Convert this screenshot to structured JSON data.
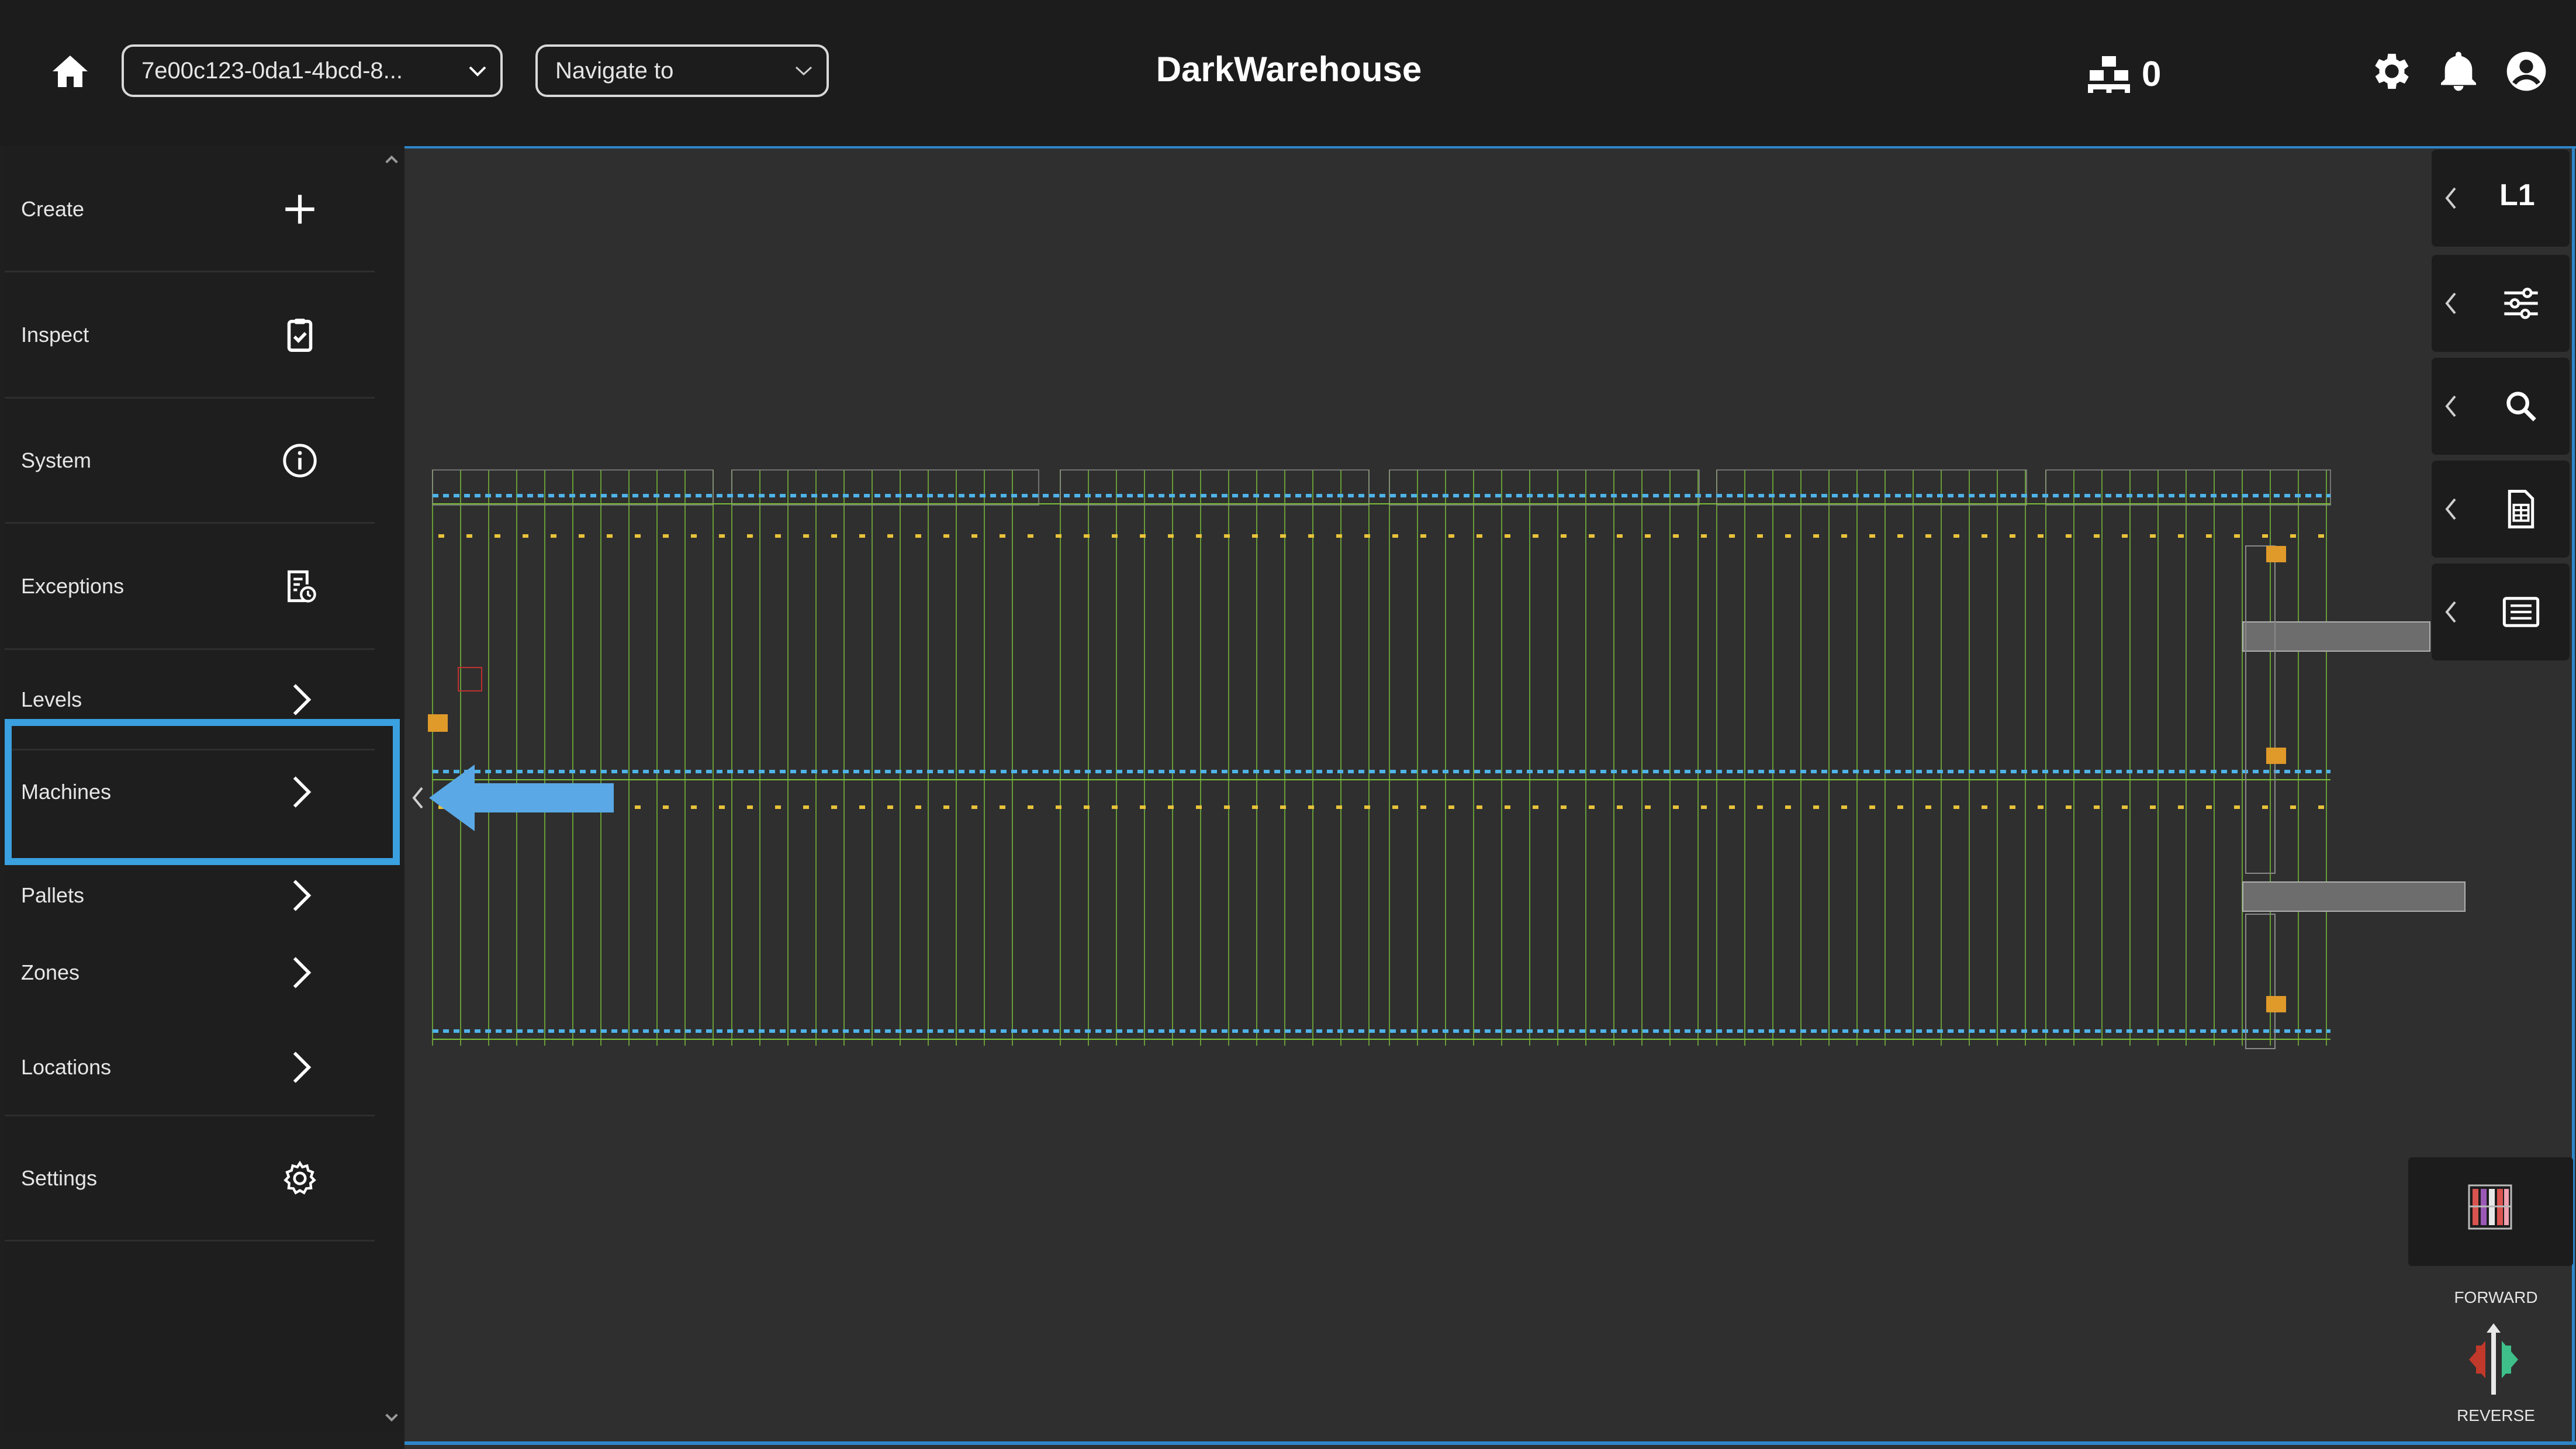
{
  "header": {
    "app_title": "DarkWarehouse",
    "site_select_value": "7e00c123-0da1-4bcd-8...",
    "navigate_placeholder": "Navigate to",
    "pallet_count": "0"
  },
  "sidebar": {
    "items": [
      {
        "label": "Create",
        "icon": "plus-icon"
      },
      {
        "label": "Inspect",
        "icon": "clipboard-check-icon"
      },
      {
        "label": "System",
        "icon": "info-icon"
      },
      {
        "label": "Exceptions",
        "icon": "report-clock-icon"
      },
      {
        "label": "Levels",
        "icon": "chevron-right-icon"
      },
      {
        "label": "Machines",
        "icon": "chevron-right-icon",
        "selected": true
      },
      {
        "label": "Pallets",
        "icon": "chevron-right-icon"
      },
      {
        "label": "Zones",
        "icon": "chevron-right-icon"
      },
      {
        "label": "Locations",
        "icon": "chevron-right-icon"
      },
      {
        "label": "Settings",
        "icon": "gear-icon"
      }
    ]
  },
  "right_panel": {
    "level_label": "L1",
    "tools": [
      "level-icon",
      "filter-sliders-icon",
      "search-icon",
      "spreadsheet-icon",
      "list-icon"
    ]
  },
  "direction": {
    "forward_label": "FORWARD",
    "reverse_label": "REVERSE"
  },
  "colors": {
    "accent": "#3aa0e0",
    "background": "#1f1f1f",
    "canvas": "#2f2f2f",
    "rack_line": "#7bbf3a",
    "conveyor": "#4fb3e8",
    "label_yellow": "#e8c23a",
    "collapse_arrow": "#5aa9e6"
  }
}
